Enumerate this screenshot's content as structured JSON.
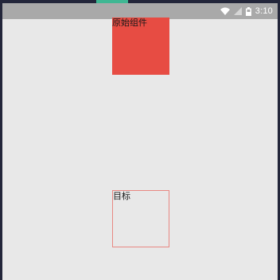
{
  "status_bar": {
    "time": "3:10",
    "icons": [
      "wifi-icon",
      "signal-icon",
      "battery-icon"
    ]
  },
  "colors": {
    "accent": "#3fb793",
    "status_bar": "#a9a9a9",
    "background": "#e8e8e8",
    "source_box": "#e74c43",
    "target_border": "#e88882"
  },
  "source_view": {
    "label": "原始组件"
  },
  "target_view": {
    "label": "目标"
  }
}
